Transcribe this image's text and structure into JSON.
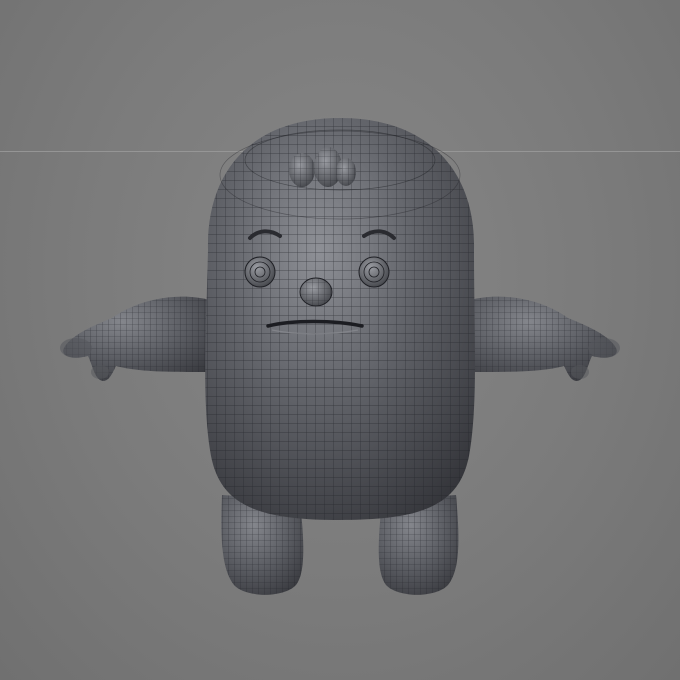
{
  "viewport": {
    "background_color": "#7a7a7a",
    "grid_line_color": "#9a9a9a"
  },
  "model": {
    "subject": "cartoon-character-wireframe",
    "pose": "t-pose",
    "shading_color": "#4a4b50",
    "highlight_color": "#8e9096",
    "wire_color": "#24252a",
    "parts": [
      "head-body",
      "left-arm",
      "right-arm",
      "left-leg",
      "right-leg",
      "hair-tuft",
      "left-eye",
      "right-eye",
      "left-eyebrow",
      "right-eyebrow",
      "nose",
      "mouth"
    ]
  }
}
